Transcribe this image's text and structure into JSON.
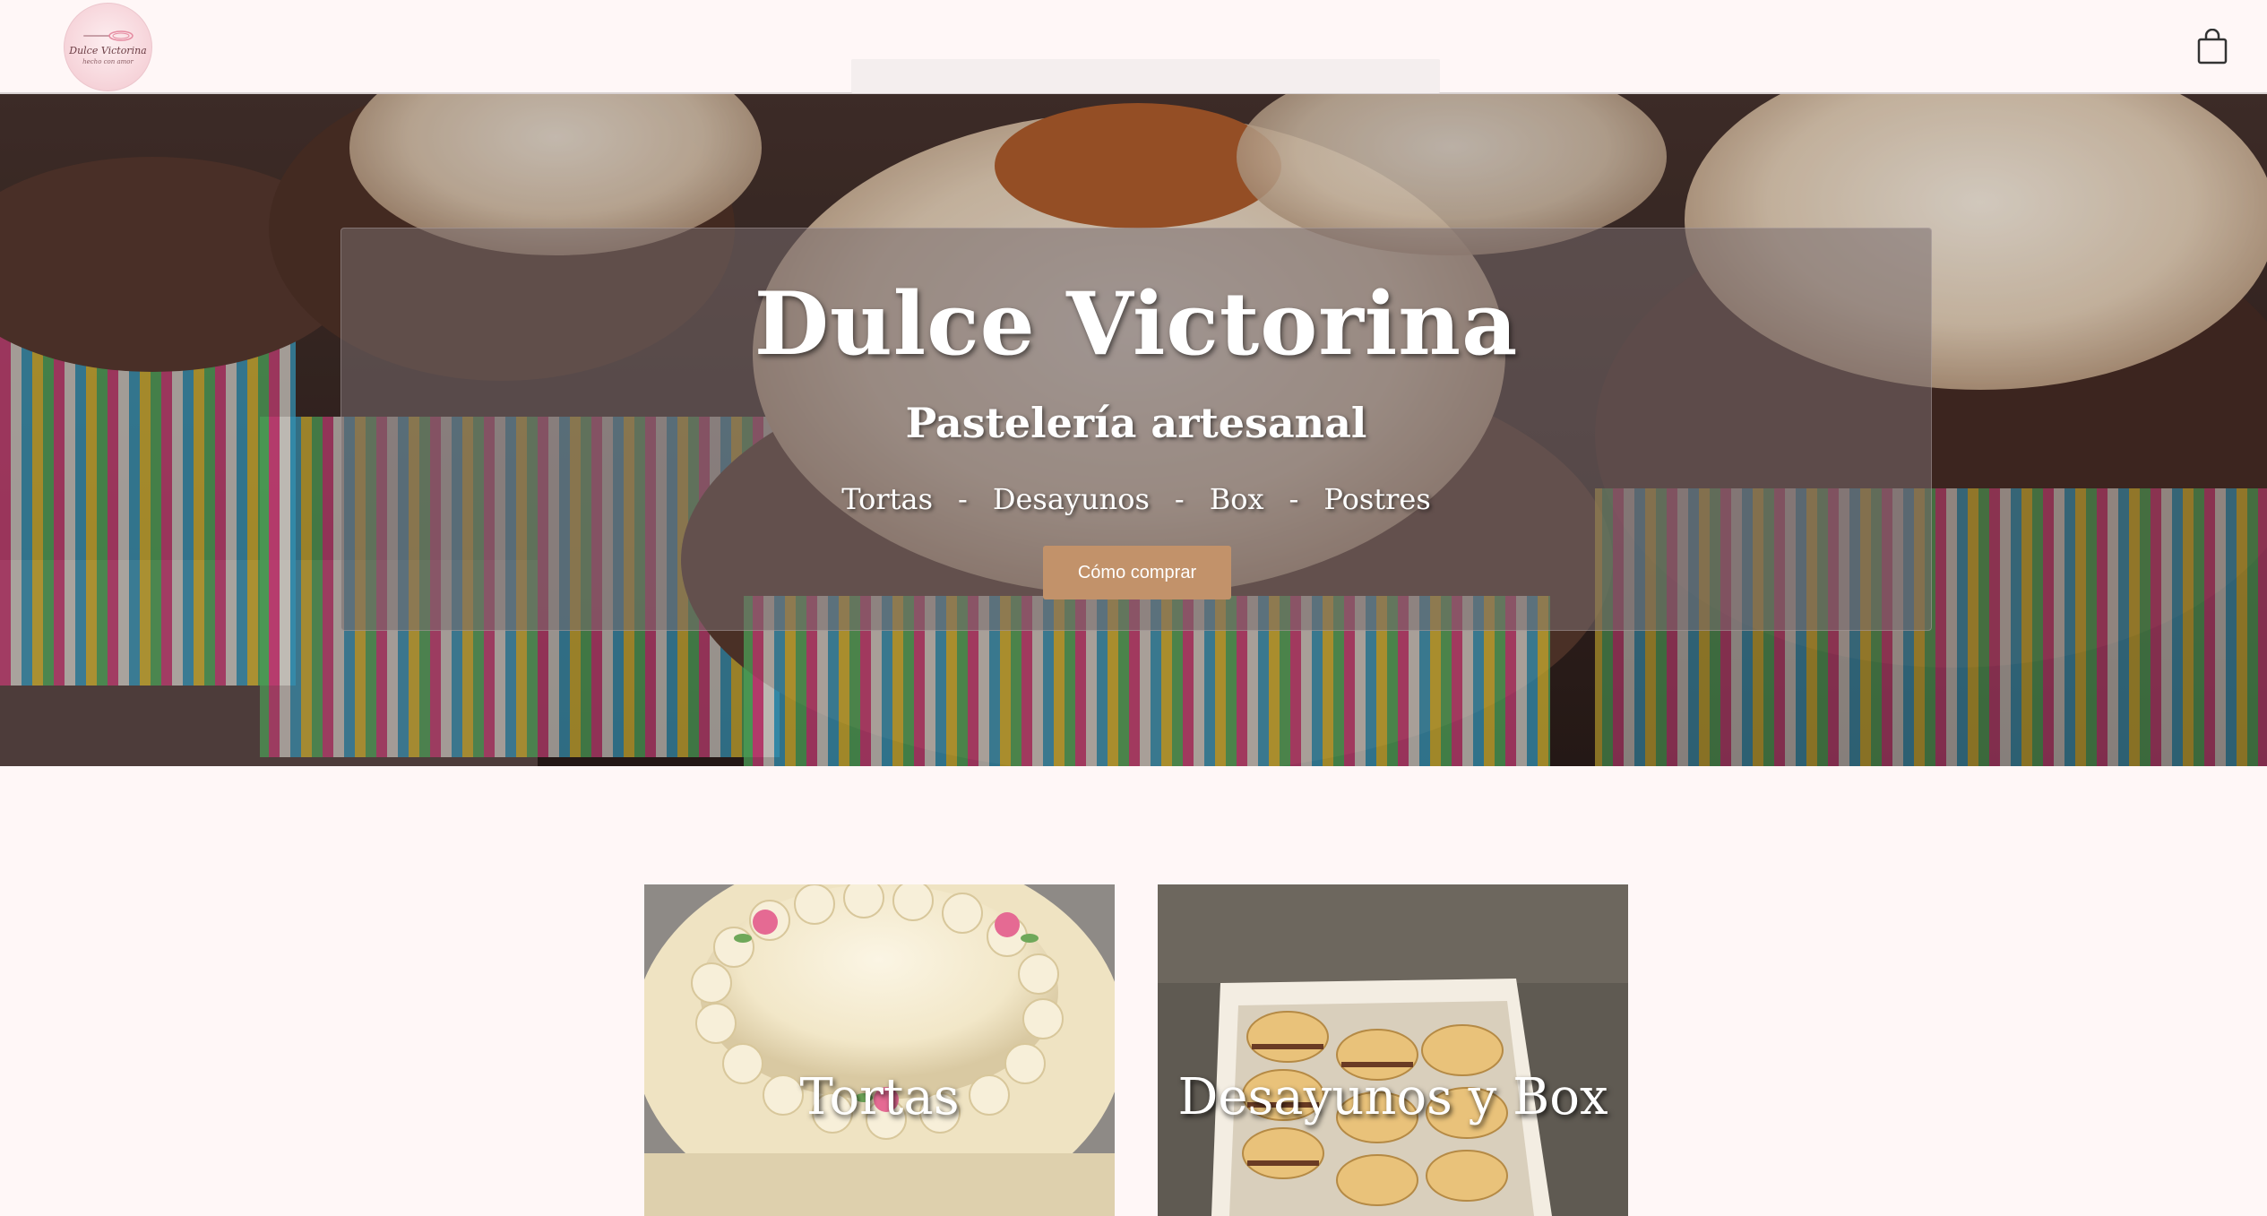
{
  "brand": {
    "logo_name": "Dulce Victorina",
    "logo_tagline": "hecho con amor"
  },
  "header": {
    "cart_icon": "shopping-bag-icon"
  },
  "hero": {
    "title": "Dulce Victorina",
    "subtitle": "Pastelería artesanal",
    "categories": [
      "Tortas",
      "Desayunos",
      "Box",
      "Postres"
    ],
    "separator": "-",
    "button_label": "Cómo comprar"
  },
  "cards": [
    {
      "label": "Tortas"
    },
    {
      "label": "Desayunos y Box"
    }
  ],
  "colors": {
    "background": "#fff7f7",
    "button": "#c2926a",
    "overlay": "#786c6e"
  }
}
